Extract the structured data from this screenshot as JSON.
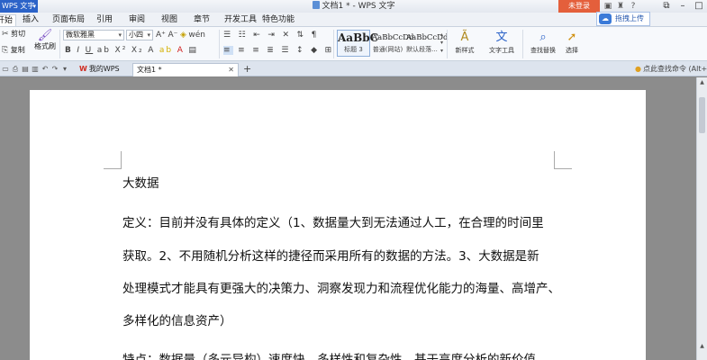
{
  "titlebar": {
    "app_menu": "WPS 文字",
    "title": "文档1 * - WPS 文字",
    "login": "未登录"
  },
  "ribbon_tabs": [
    "开始",
    "插入",
    "页面布局",
    "引用",
    "审阅",
    "视图",
    "章节",
    "开发工具",
    "特色功能"
  ],
  "upload_label": "拖拽上传",
  "ribbon": {
    "cut": "剪切",
    "copy": "复制",
    "format_painter": "格式刷",
    "font_name": "微软雅黑",
    "font_size": "小四",
    "styles": [
      {
        "sample": "AaBbC",
        "name": "标题 3"
      },
      {
        "sample": "AaBbCcDd",
        "name": "普通(网站)"
      },
      {
        "sample": "AaBbCcDd",
        "name": "默认段落..."
      }
    ],
    "new_style": "新样式",
    "text_tool": "文字工具",
    "find_replace": "查找替换",
    "select": "选择"
  },
  "tabs": {
    "wps_tab": "我的WPS",
    "doc_tab": "文档1 *",
    "cmd_search": "点此查找命令 (Alt+Q)"
  },
  "document": {
    "paragraphs": [
      "大数据",
      "定义：目前并没有具体的定义（1、数据量大到无法通过人工，在合理的时间里",
      "获取。2、不用随机分析这样的捷径而采用所有的数据的方法。3、大数据是新",
      "处理模式才能具有更强大的决策力、洞察发现力和流程优化能力的海量、高增产、",
      "多样化的信息资产）",
      "特点：数据量（多元异构）速度快，多样性和复杂性，基于高度分析的新价值"
    ]
  },
  "colors": {
    "accent": "#2c63c8",
    "login": "#e45f3b"
  }
}
